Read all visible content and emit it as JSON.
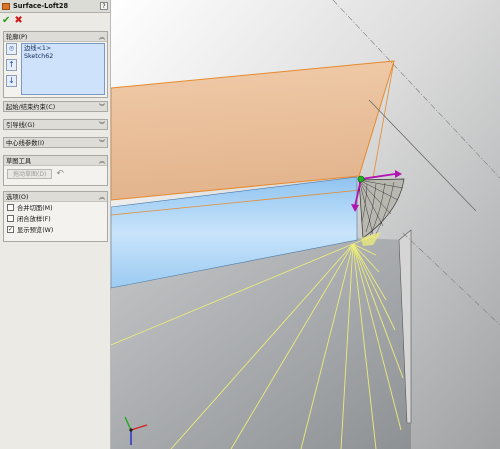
{
  "feature": {
    "title": "Surface-Loft28",
    "help_label": "?",
    "ok_icon": "green-check-icon",
    "cancel_icon": "red-x-icon"
  },
  "profiles": {
    "header": "轮廓(P)",
    "items": [
      "边线<1>",
      "Sketch62"
    ]
  },
  "sections": {
    "constraints": "起始/结束约束(C)",
    "guides": "引导线(G)",
    "centerline": "中心线参数(I)"
  },
  "sketch_tools": {
    "header": "草图工具",
    "drag_button": "拖动草图(D)"
  },
  "options": {
    "header": "选项(O)",
    "items": [
      {
        "label": "合并切面(M)",
        "checked": false
      },
      {
        "label": "闭合放样(F)",
        "checked": false
      },
      {
        "label": "显示预览(W)",
        "checked": true
      }
    ]
  },
  "colors": {
    "panel_bg": "#eceae5",
    "list_bg": "#cfe2fb",
    "surface_orange": "#e9b98f",
    "surface_blue": "#a9d3f6",
    "preview_yellow": "#ecec7a"
  }
}
